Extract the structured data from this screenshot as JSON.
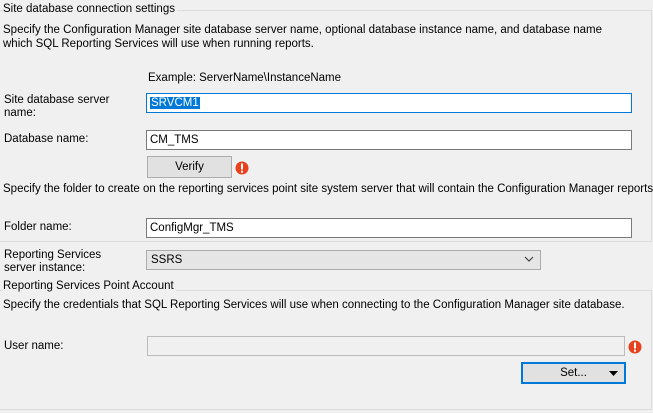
{
  "site_db_group": {
    "title": "Site database connection settings",
    "description": "Specify the Configuration Manager site database server name, optional database instance name, and database name which SQL Reporting Services will use when running reports.",
    "example": "Example: ServerName\\InstanceName",
    "server_label": "Site database server name:",
    "server_value": "SRVCM1",
    "database_label": "Database name:",
    "database_value": "CM_TMS",
    "verify_label": "Verify"
  },
  "folder": {
    "description": "Specify the folder to create on the reporting services point site system server that will contain the Configuration Manager reports.",
    "label": "Folder name:",
    "value": "ConfigMgr_TMS"
  },
  "rs_instance": {
    "label": "Reporting Services server instance:",
    "selected": "SSRS"
  },
  "account_group": {
    "title": "Reporting Services Point Account",
    "description": "Specify the credentials that SQL Reporting Services will use when connecting to the Configuration Manager site database.",
    "username_label": "User name:",
    "username_value": "",
    "set_label": "Set..."
  },
  "colors": {
    "accent": "#0078d7",
    "error": "#e8411d",
    "window_bg": "#f0f0f0"
  }
}
